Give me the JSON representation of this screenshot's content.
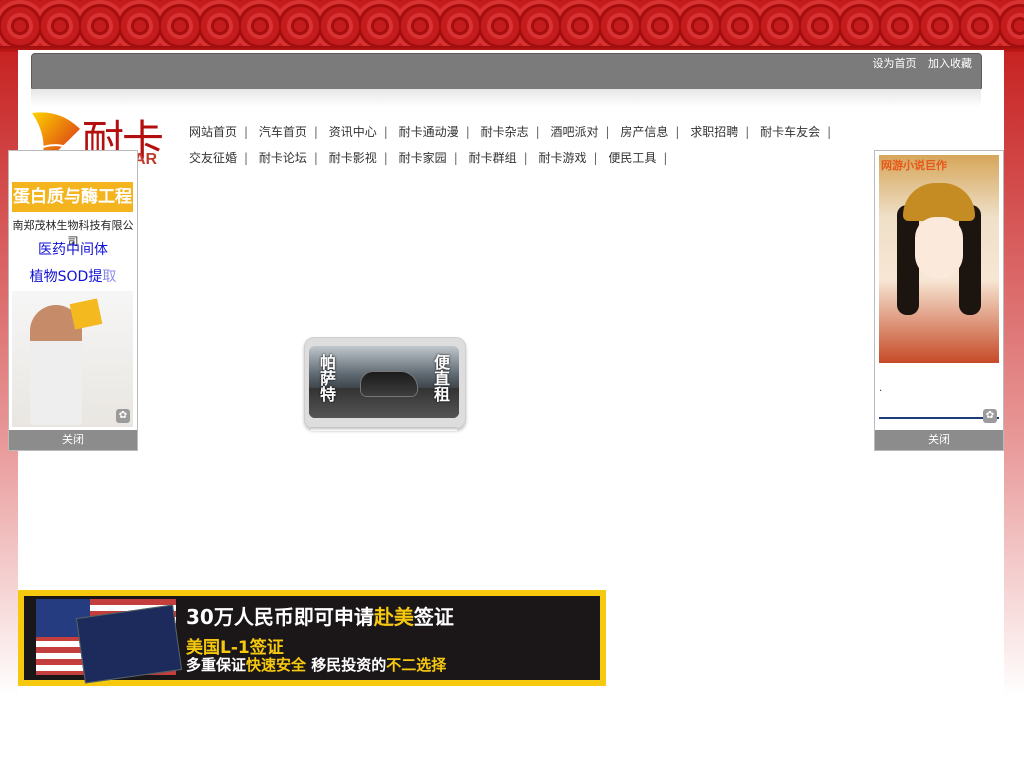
{
  "colors": {
    "brand_red": "#b41212",
    "topbar_grey": "#7b7b7b",
    "banner_yellow": "#f6c90e",
    "link_blue": "#1010d6"
  },
  "top_links": [
    "设为首页",
    "加入收藏"
  ],
  "logo": {
    "chars": "耐卡",
    "sub": "AR"
  },
  "nav": {
    "row1": [
      "网站首页",
      "汽车首页",
      "资讯中心",
      "耐卡通动漫",
      "耐卡杂志",
      "酒吧派对",
      "房产信息",
      "求职招聘",
      "耐卡车友会"
    ],
    "row2": [
      "交友征婚",
      "耐卡论坛",
      "耐卡影视",
      "耐卡家园",
      "耐卡群组",
      "耐卡游戏",
      "便民工具"
    ],
    "separator": "|"
  },
  "float_left": {
    "headline": "蛋白质与酶工程",
    "company": "南郑茂林生物科技有限公司",
    "line1": "医药中间体",
    "line2_main": "植物SOD提",
    "line2_light": "取",
    "close_label": "关闭",
    "icon": "paw-icon"
  },
  "float_right": {
    "title": "网游小说巨作",
    "dot": ".",
    "close_label": "关闭",
    "icon": "paw-icon"
  },
  "slide": {
    "left_text": "帕萨特",
    "right_text": "便直租"
  },
  "banner": {
    "line1_white_a": "30万人民币即可申请",
    "line1_yellow": "赴美",
    "line1_white_b": "签证",
    "line2": "美国L-1签证",
    "line3_white_a": "多重保证",
    "line3_yellow_a": "快速安全",
    "line3_white_b": " 移民投资的",
    "line3_yellow_b": "不二选择"
  }
}
